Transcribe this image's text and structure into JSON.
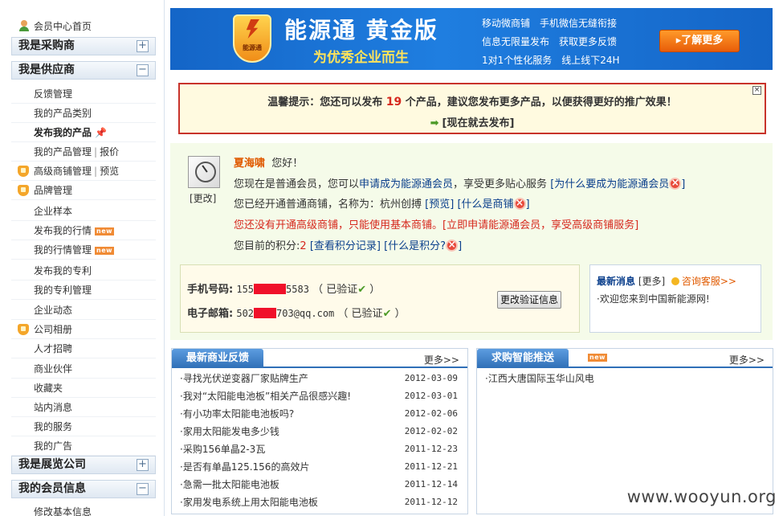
{
  "sidebar": {
    "home_label": "会员中心首页",
    "sections": {
      "buyer": {
        "title": "我是采购商",
        "toggle": "+"
      },
      "supplier": {
        "title": "我是供应商",
        "toggle": "−"
      },
      "expo": {
        "title": "我是展览公司",
        "toggle": "+"
      },
      "member": {
        "title": "我的会员信息",
        "toggle": "−"
      }
    },
    "items": {
      "feedback": "反馈管理",
      "category": "我的产品类别",
      "publish": "发布我的产品",
      "products": "我的产品管理",
      "quote": "报价",
      "advshop": "高级商铺管理",
      "preview": "预览",
      "brand": "品牌管理",
      "samples": "企业样本",
      "pubmarket": "发布我的行情",
      "mymarket": "我的行情管理",
      "pubpatent": "发布我的专利",
      "mypatent": "我的专利管理",
      "news": "企业动态",
      "album": "公司相册",
      "hr": "人才招聘",
      "partners": "商业伙伴",
      "favorites": "收藏夹",
      "messages": "站内消息",
      "services": "我的服务",
      "ads": "我的广告",
      "basic": "修改基本信息",
      "new_badge": "new",
      "sep": "|"
    }
  },
  "banner": {
    "logo_text": "能源通",
    "title": "能源通 黄金版",
    "slogan": "为优秀企业而生",
    "right_lines": [
      "移动微商铺　手机微信无缝衔接",
      "信息无限量发布　获取更多反馈",
      "1对1个性化服务　线上线下24H"
    ],
    "button": "▸了解更多"
  },
  "tip": {
    "prefix": "温馨提示：您还可以发布 ",
    "count": "19",
    "suffix": " 个产品，建议您发布更多产品，以便获得更好的推广效果！",
    "publish_link": "[现在就去发布]",
    "close": "×"
  },
  "user": {
    "change_avatar": "[更改]",
    "name": "夏海啸",
    "greeting": "您好！",
    "line1_text": "您现在是普通会员，您可以",
    "line1_link": "申请成为能源通会员",
    "line1_tail": "，享受更多贴心服务",
    "line1_why": "[为什么要成为能源通会员",
    "line2_text": "您已经开通普通商铺，名称为：杭州创搏",
    "line2_preview": "[预览]",
    "line2_what": "[什么是商铺",
    "line3_text": "您还没有开通高级商铺，只能使用基本商铺。",
    "line3_link": "[立即申请能源通会员，享受高级商铺服务]",
    "line4_text": "您目前的积分:",
    "points": "2",
    "line4_records": "[查看积分记录]",
    "line4_what": "[什么是积分?",
    "close_bracket": "]"
  },
  "contact": {
    "phone_label": "手机号码:",
    "phone_a": "155",
    "phone_b": "5583",
    "email_label": "电子邮箱:",
    "email_a": "502",
    "email_b": "703@qq.com",
    "verified": "已验证",
    "button": "更改验证信息"
  },
  "news": {
    "title": "最新消息",
    "more": "[更多]",
    "service": "咨询客服>>",
    "item": "·欢迎您来到中国新能源网!"
  },
  "feedback_panel": {
    "tab": "最新商业反馈",
    "more": "更多>>",
    "rows": [
      {
        "t": "·寻找光伏逆变器厂家贴牌生产",
        "d": "2012-03-09"
      },
      {
        "t": "·我对“太阳能电池板”相关产品很感兴趣!",
        "d": "2012-03-01"
      },
      {
        "t": "·有小功率太阳能电池板吗?",
        "d": "2012-02-06"
      },
      {
        "t": "·家用太阳能发电多少钱",
        "d": "2012-02-02"
      },
      {
        "t": "·采购156单晶2-3瓦",
        "d": "2011-12-23"
      },
      {
        "t": "·是否有单晶125.156的高效片",
        "d": "2011-12-21"
      },
      {
        "t": "·急需一批太阳能电池板",
        "d": "2011-12-14"
      },
      {
        "t": "·家用发电系统上用太阳能电池板",
        "d": "2011-12-12"
      }
    ]
  },
  "push_panel": {
    "tab": "求购智能推送",
    "badge": "new",
    "more": "更多>>",
    "rows": [
      {
        "t": "·江西大唐国际玉华山风电"
      }
    ]
  },
  "watermark": "www.wooyun.org"
}
